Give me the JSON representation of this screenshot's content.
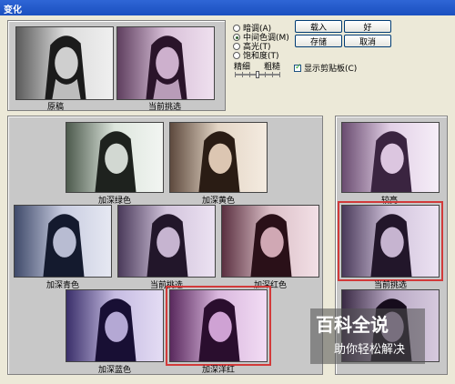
{
  "window": {
    "title": "变化"
  },
  "originals": [
    {
      "label": "原稿"
    },
    {
      "label": "当前挑选"
    }
  ],
  "radios": [
    {
      "label": "暗调(A)",
      "checked": false
    },
    {
      "label": "中间色调(M)",
      "checked": true
    },
    {
      "label": "高光(T)",
      "checked": false
    },
    {
      "label": "饱和度(T)",
      "checked": false
    }
  ],
  "slider": {
    "fine": "精细",
    "coarse": "粗糙"
  },
  "buttons": {
    "load": "载入",
    "ok": "好",
    "save": "存储",
    "cancel": "取消"
  },
  "show_clipping": {
    "label": "显示剪贴板(C)",
    "checked": true
  },
  "color_variants": {
    "green": "加深绿色",
    "yellow": "加深黄色",
    "cyan": "加深青色",
    "current": "当前挑选",
    "red": "加深红色",
    "blue": "加深蓝色",
    "magenta": "加深洋红"
  },
  "brightness": {
    "lighter": "较亮",
    "current": "当前挑选"
  },
  "watermark": {
    "main": "百科全说",
    "sub": "助你轻松解决"
  }
}
